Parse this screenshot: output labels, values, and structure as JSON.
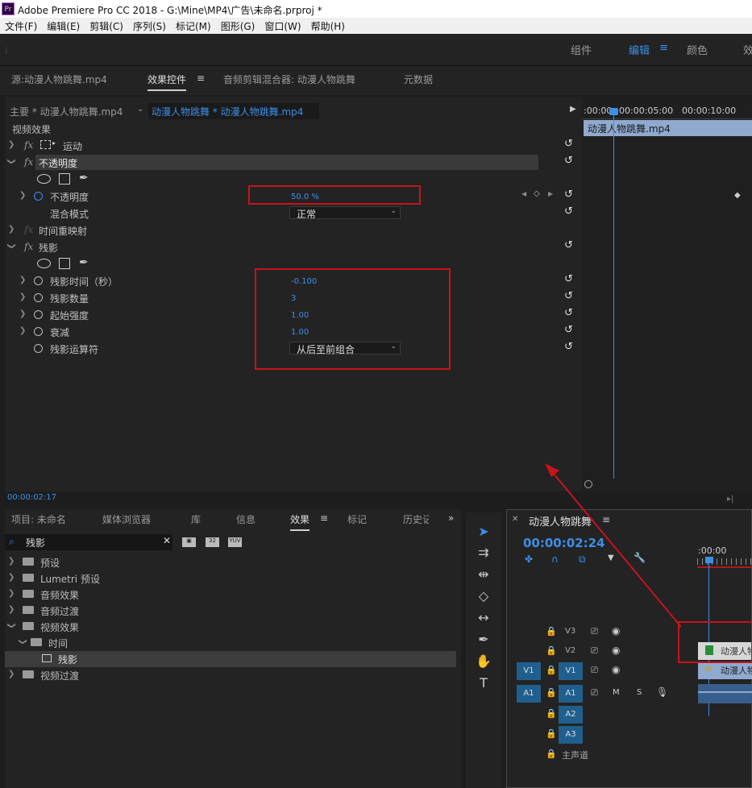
{
  "window": {
    "title": "Adobe Premiere Pro CC 2018 - G:\\Mine\\MP4\\广告\\未命名.prproj *",
    "app_icon": "Pr"
  },
  "menu": [
    "文件(F)",
    "编辑(E)",
    "剪辑(C)",
    "序列(S)",
    "标记(M)",
    "图形(G)",
    "窗口(W)",
    "帮助(H)"
  ],
  "workspaces": {
    "items": [
      "组件",
      "编辑",
      "颜色"
    ],
    "active": "编辑",
    "overflow": "效"
  },
  "tabs": {
    "source": "源:动漫人物跳舞.mp4",
    "effect_controls": "效果控件",
    "audio_mixer": "音频剪辑混合器: 动漫人物跳舞",
    "metadata": "元数据"
  },
  "ec": {
    "master_label": "主要 * 动漫人物跳舞.mp4",
    "clip_label": "动漫人物跳舞 * 动漫人物跳舞.mp4",
    "section_video": "视频效果",
    "motion": "运动",
    "opacity_group": "不透明度",
    "opacity_label": "不透明度",
    "opacity_value": "50.0 %",
    "blend_label": "混合模式",
    "blend_value": "正常",
    "time_remap": "时间重映射",
    "echo_group": "残影",
    "echo_time_label": "残影时间（秒）",
    "echo_time_value": "-0.100",
    "echo_count_label": "残影数量",
    "echo_count_value": "3",
    "start_intensity_label": "起始强度",
    "start_intensity_value": "1.00",
    "decay_label": "衰减",
    "decay_value": "1.00",
    "operator_label": "残影运算符",
    "operator_value": "从后至前组合",
    "timecode": "00:00:02:17"
  },
  "mini_timeline": {
    "t0": ":00:00",
    "t1": "00:00:05:00",
    "t2": "00:00:10:00",
    "clip": "动漫人物跳舞.mp4"
  },
  "project_tabs": [
    "项目: 未命名",
    "媒体浏览器",
    "库",
    "信息",
    "效果",
    "标记",
    "历史记"
  ],
  "search": {
    "value": "残影"
  },
  "effects_tree": [
    "预设",
    "Lumetri 预设",
    "音频效果",
    "音频过渡",
    "视频效果",
    "时间",
    "残影",
    "视频过渡"
  ],
  "timeline": {
    "title": "动漫人物跳舞",
    "timecode": "00:00:02:24",
    "ruler": ":00:00",
    "tracks": [
      "V3",
      "V2",
      "V1",
      "A1",
      "A2",
      "A3",
      "主声道"
    ],
    "src_v": "V1",
    "src_a": "A1",
    "clip_v2": "动漫人物",
    "clip_v1": "动漫人物",
    "m": "M",
    "s": "S"
  },
  "colors": {
    "accent": "#3d8ee6",
    "red": "#c8131c",
    "clip": "#8fa9cf"
  }
}
